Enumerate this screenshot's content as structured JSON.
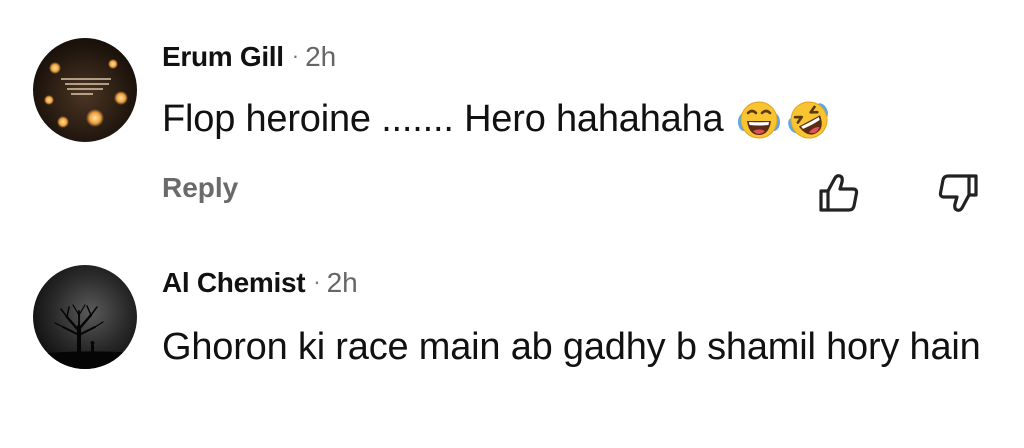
{
  "comments": [
    {
      "author": "Erum Gill",
      "separator": "·",
      "time": "2h",
      "text": "Flop heroine ....... Hero hahahaha",
      "emojis": [
        "face-with-tears-of-joy-icon",
        "rolling-on-the-floor-laughing-icon"
      ],
      "reply_label": "Reply",
      "avatar_icon": "candles-photo-avatar"
    },
    {
      "author": "Al Chemist",
      "separator": "·",
      "time": "2h",
      "text": "Ghoron ki race main ab gadhy b shamil hory hain",
      "avatar_icon": "tree-silhouette-avatar"
    }
  ],
  "actions": {
    "like_icon": "thumbs-up-icon",
    "dislike_icon": "thumbs-down-icon"
  },
  "colors": {
    "text": "#111111",
    "muted": "#6a6a6a",
    "emoji_yellow": "#f9c432",
    "tear_blue": "#5aa8e8"
  }
}
